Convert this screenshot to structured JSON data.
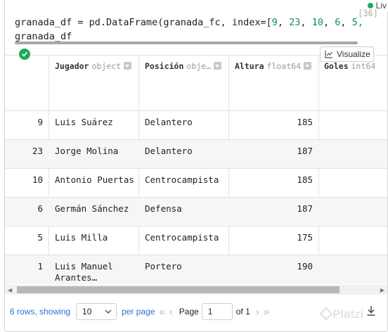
{
  "badge": {
    "label": "Liv"
  },
  "cell": {
    "exec_count": "[36]",
    "code_line1_a": "granada_df = pd.DataFrame(granada_fc, index=[",
    "code_line1_nums": [
      "9",
      "23",
      "10",
      "6",
      "5,"
    ],
    "code_line2": "granada_df"
  },
  "toolbar": {
    "visualize_label": "Visualize"
  },
  "table": {
    "columns": [
      {
        "name": "Jugador",
        "dtype": "object"
      },
      {
        "name": "Posición",
        "dtype": "obje…"
      },
      {
        "name": "Altura",
        "dtype": "float64"
      },
      {
        "name": "Goles",
        "dtype": "int64"
      }
    ],
    "rows": [
      {
        "index": "9",
        "jugador": "Luis Suárez",
        "jugador2": "",
        "posicion": "Delantero",
        "altura": "185"
      },
      {
        "index": "23",
        "jugador": "Jorge Molina",
        "jugador2": "",
        "posicion": "Delantero",
        "altura": "187"
      },
      {
        "index": "10",
        "jugador": "Antonio Puertas",
        "jugador2": "",
        "posicion": "Centrocampista",
        "altura": "185"
      },
      {
        "index": "6",
        "jugador": "Germán Sánchez",
        "jugador2": "",
        "posicion": "Defensa",
        "altura": "187"
      },
      {
        "index": "5",
        "jugador": "Luis Milla",
        "jugador2": "",
        "posicion": "Centrocampista",
        "altura": "175"
      },
      {
        "index": "1",
        "jugador": "Luis Manuel",
        "jugador2": "Arantes…",
        "posicion": "Portero",
        "altura": "190"
      }
    ]
  },
  "pager": {
    "rows_info": "6 rows, showing",
    "page_size": "10",
    "per_page": "per page",
    "page_label": "Page",
    "page_value": "1",
    "of_label": "of 1"
  },
  "watermark": "Platzi"
}
